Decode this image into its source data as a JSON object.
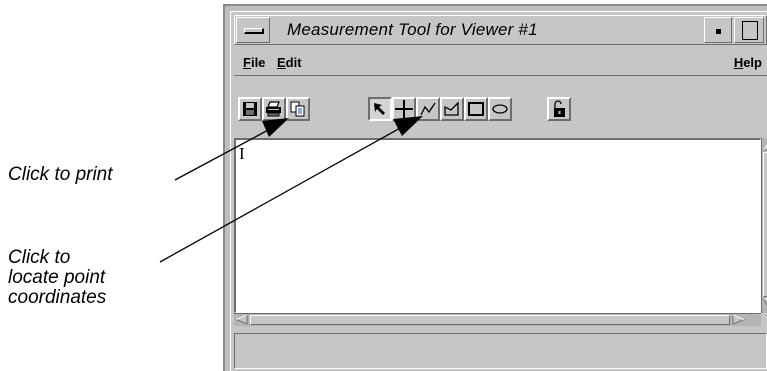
{
  "window": {
    "title": "Measurement Tool for Viewer #1"
  },
  "menubar": {
    "file_label": "File",
    "edit_label": "Edit",
    "help_label": "Help"
  },
  "toolbar": {
    "buttons": [
      {
        "icon": "save-icon"
      },
      {
        "icon": "print-icon"
      },
      {
        "icon": "copy-icon"
      },
      {
        "icon": "select-arrow-icon",
        "pressed": true
      },
      {
        "icon": "point-crosshair-icon"
      },
      {
        "icon": "polyline-icon"
      },
      {
        "icon": "polygon-icon"
      },
      {
        "icon": "rectangle-icon"
      },
      {
        "icon": "ellipse-icon"
      },
      {
        "icon": "lock-icon"
      }
    ]
  },
  "textarea": {
    "caret": "I"
  },
  "statusbar": {
    "text": ""
  },
  "annotations": {
    "print_callout": "Click to print",
    "locate_callout_line1": "Click to",
    "locate_callout_line2": "locate point",
    "locate_callout_line3": "coordinates"
  },
  "colors": {
    "window_bg": "#c6c6c6",
    "highlight": "#ffffff",
    "shadow": "#6e6e6e",
    "text_area_bg": "#ffffff"
  }
}
